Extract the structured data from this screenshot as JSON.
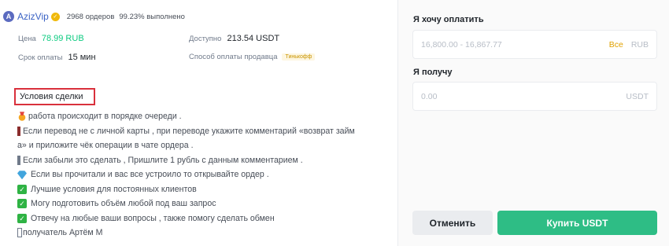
{
  "seller": {
    "avatar_letter": "A",
    "name": "AzizVip",
    "orders": "2968 ордеров",
    "completion": "99.23% выполнено"
  },
  "info": {
    "price_label": "Цена",
    "price_value": "78.99 RUB",
    "available_label": "Доступно",
    "available_value": "213.54 USDT",
    "term_label": "Срок оплаты",
    "term_value": "15 мин",
    "method_label": "Способ оплаты продавца",
    "method_value": "Тинькофф"
  },
  "terms": {
    "title": "Условия сделки",
    "lines": [
      "работа происходит в порядке очереди .",
      "Если перевод не с личной карты , при переводе укажите комментарий «возврат займ",
      "а» и приложите чёк операции в чате ордера .",
      "Если забыли это сделать , Пришлите 1 рубль с данным комментарием .",
      "Если вы прочитали и вас все устроило то открывайте ордер .",
      "Лучшие условия для постоянных клиентов",
      "Могу подготовить объём любой под ваш запрос",
      "Отвечу на любые ваши вопросы , также помогу сделать обмен",
      "получатель Артём М"
    ]
  },
  "pay": {
    "label": "Я хочу оплатить",
    "placeholder": "16,800.00 - 16,867.77",
    "all_label": "Все",
    "currency": "RUB"
  },
  "receive": {
    "label": "Я получу",
    "placeholder": "0.00",
    "currency": "USDT"
  },
  "buttons": {
    "cancel": "Отменить",
    "buy": "Купить USDT"
  },
  "colors": {
    "accent_green": "#2ebd85",
    "price_green": "#0ecb81",
    "highlight_red": "#d9303c",
    "all_yellow": "#e0a100"
  }
}
